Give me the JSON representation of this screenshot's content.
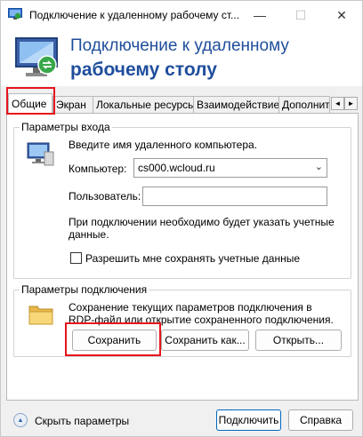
{
  "window": {
    "title": "Подключение к удаленному рабочему ст...",
    "minimize_glyph": "—",
    "maximize_glyph": "☐",
    "close_glyph": "✕"
  },
  "banner": {
    "line1": "Подключение к удаленному",
    "line2": "рабочему столу"
  },
  "tabs": [
    {
      "label": "Общие",
      "active": true
    },
    {
      "label": "Экран",
      "active": false
    },
    {
      "label": "Локальные ресурсы",
      "active": false
    },
    {
      "label": "Взаимодействие",
      "active": false
    },
    {
      "label": "Дополнительно",
      "active": false
    }
  ],
  "tab_scroll": {
    "left": "◄",
    "right": "►"
  },
  "login_group": {
    "title": "Параметры входа",
    "prompt": "Введите имя удаленного компьютера.",
    "computer_label": "Компьютер:",
    "computer_value": "cs000.wcloud.ru",
    "combo_arrow": "⌄",
    "user_label": "Пользователь:",
    "user_value": "",
    "info_line1": "При подключении необходимо будет указать учетные",
    "info_line2": "данные.",
    "checkbox_label": "Разрешить мне сохранять учетные данные",
    "checkbox_checked": false
  },
  "connection_group": {
    "title": "Параметры подключения",
    "desc_line1": "Сохранение текущих параметров подключения в",
    "desc_line2": "RDP-файл или открытие сохраненного подключения.",
    "save_button": "Сохранить",
    "save_as_button": "Сохранить как...",
    "open_button": "Открыть..."
  },
  "footer": {
    "hide_options": "Скрыть параметры",
    "connect_button": "Подключить",
    "help_button": "Справка"
  },
  "colors": {
    "accent": "#0067c0",
    "banner_text": "#1f4e9c",
    "highlight": "#e8141b"
  },
  "icons": [
    "rdp-app-icon",
    "rdp-logo-icon",
    "computer-icon",
    "folder-icon",
    "collapse-icon"
  ]
}
